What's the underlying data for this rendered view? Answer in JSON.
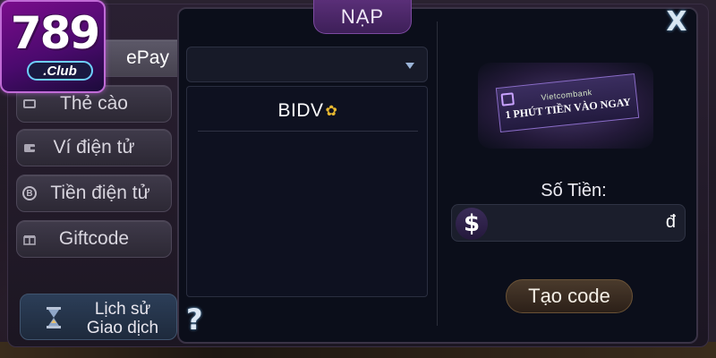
{
  "logo": {
    "number": "789",
    "suffix": ".Club"
  },
  "header": {
    "title": "NẠP",
    "close_label": "X"
  },
  "sidebar": {
    "items": [
      {
        "label": "ePay",
        "icon": "bank-icon",
        "active": true
      },
      {
        "label": "Thẻ cào",
        "icon": "card-icon"
      },
      {
        "label": "Ví điện tử",
        "icon": "wallet-icon"
      },
      {
        "label": "Tiền điện tử",
        "icon": "bitcoin-icon",
        "icon_glyph": "B"
      },
      {
        "label": "Giftcode",
        "icon": "gift-icon"
      }
    ],
    "history": {
      "line1": "Lịch sử",
      "line2": "Giao dịch"
    }
  },
  "bank_select": {
    "selected": "",
    "options": [
      {
        "name": "BIDV"
      }
    ]
  },
  "help_label": "?",
  "banner": {
    "brand": "Vietcombank",
    "text": "1 PHÚT TIỀN VÀO NGAY"
  },
  "amount": {
    "label": "Số Tiền:",
    "value": "",
    "currency_symbol": "$",
    "unit": "đ"
  },
  "create_button": "Tạo code",
  "colors": {
    "panel_bg": "#0b0e1a",
    "title_tab": "#5a2f78",
    "logo_bg": "#7a0c8c"
  }
}
